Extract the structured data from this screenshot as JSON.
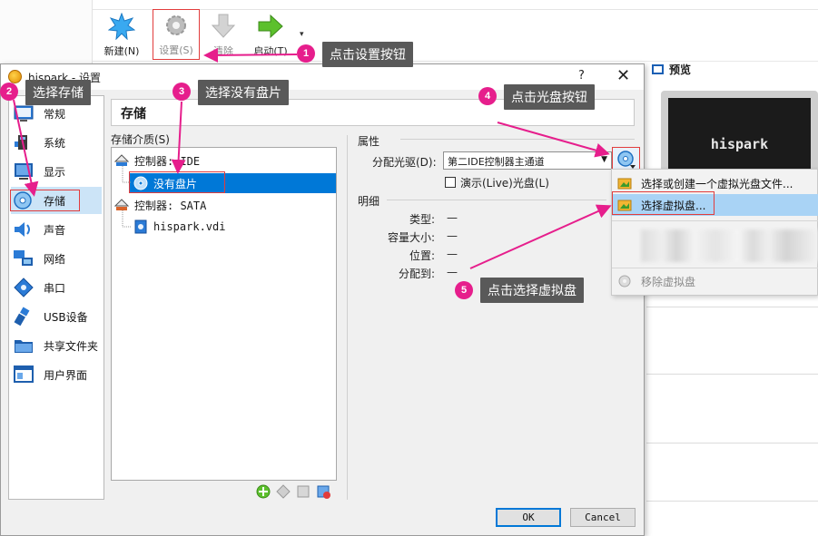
{
  "toolbar": {
    "new_label": "新建(N)",
    "settings_label": "设置(S)",
    "discard_label": "清除",
    "start_label": "启动(T)",
    "dropdown_glyph": "▾"
  },
  "preview": {
    "title": "预览",
    "screen_text": "hispark"
  },
  "dialog": {
    "title": "hispark - 设置",
    "help_glyph": "?",
    "close_glyph": "✕",
    "header": "存储",
    "nav": [
      {
        "label": "常规",
        "icon": "general-icon"
      },
      {
        "label": "系统",
        "icon": "system-icon"
      },
      {
        "label": "显示",
        "icon": "display-icon"
      },
      {
        "label": "存储",
        "icon": "storage-icon"
      },
      {
        "label": "声音",
        "icon": "audio-icon"
      },
      {
        "label": "网络",
        "icon": "network-icon"
      },
      {
        "label": "串口",
        "icon": "serial-port-icon"
      },
      {
        "label": "USB设备",
        "icon": "usb-icon"
      },
      {
        "label": "共享文件夹",
        "icon": "shared-folder-icon"
      },
      {
        "label": "用户界面",
        "icon": "user-interface-icon"
      }
    ],
    "active_nav": "存储",
    "storage_media_label": "存储介质(S)",
    "tree": [
      {
        "label": "控制器: IDE",
        "type": "controller"
      },
      {
        "label": "没有盘片",
        "type": "optical",
        "selected": true
      },
      {
        "label": "控制器: SATA",
        "type": "controller"
      },
      {
        "label": "hispark.vdi",
        "type": "disk"
      }
    ],
    "attributes": {
      "title": "属性",
      "optical_drive_label": "分配光驱(D):",
      "optical_drive_value": "第二IDE控制器主通道",
      "live_cd_label": "演示(Live)光盘(L)",
      "live_cd_checked": false
    },
    "details": {
      "title": "明细",
      "rows": [
        {
          "key": "类型:",
          "value": "—"
        },
        {
          "key": "容量大小:",
          "value": "—"
        },
        {
          "key": "位置:",
          "value": "—"
        },
        {
          "key": "分配到:",
          "value": "—"
        }
      ]
    },
    "ok_label": "OK",
    "cancel_label": "Cancel"
  },
  "menu": {
    "items": [
      {
        "label": "选择或创建一个虚拟光盘文件...",
        "icon": "folder-image-icon"
      },
      {
        "label": "选择虚拟盘...",
        "icon": "folder-image-icon",
        "highlighted": true
      },
      {
        "label": "移除虚拟盘",
        "icon": "remove-disk-icon",
        "disabled": true
      }
    ]
  },
  "annotations": [
    {
      "number": "1",
      "text": "点击设置按钮"
    },
    {
      "number": "2",
      "text": "选择存储"
    },
    {
      "number": "3",
      "text": "选择没有盘片"
    },
    {
      "number": "4",
      "text": "点击光盘按钮"
    },
    {
      "number": "5",
      "text": "点击选择虚拟盘"
    }
  ],
  "colors": {
    "annotation_badge": "#e61e8c",
    "annotation_arrow": "#e61e8c",
    "callout_bg": "#595959",
    "highlight_box": "#e23c3c",
    "selection": "#0078d7"
  }
}
